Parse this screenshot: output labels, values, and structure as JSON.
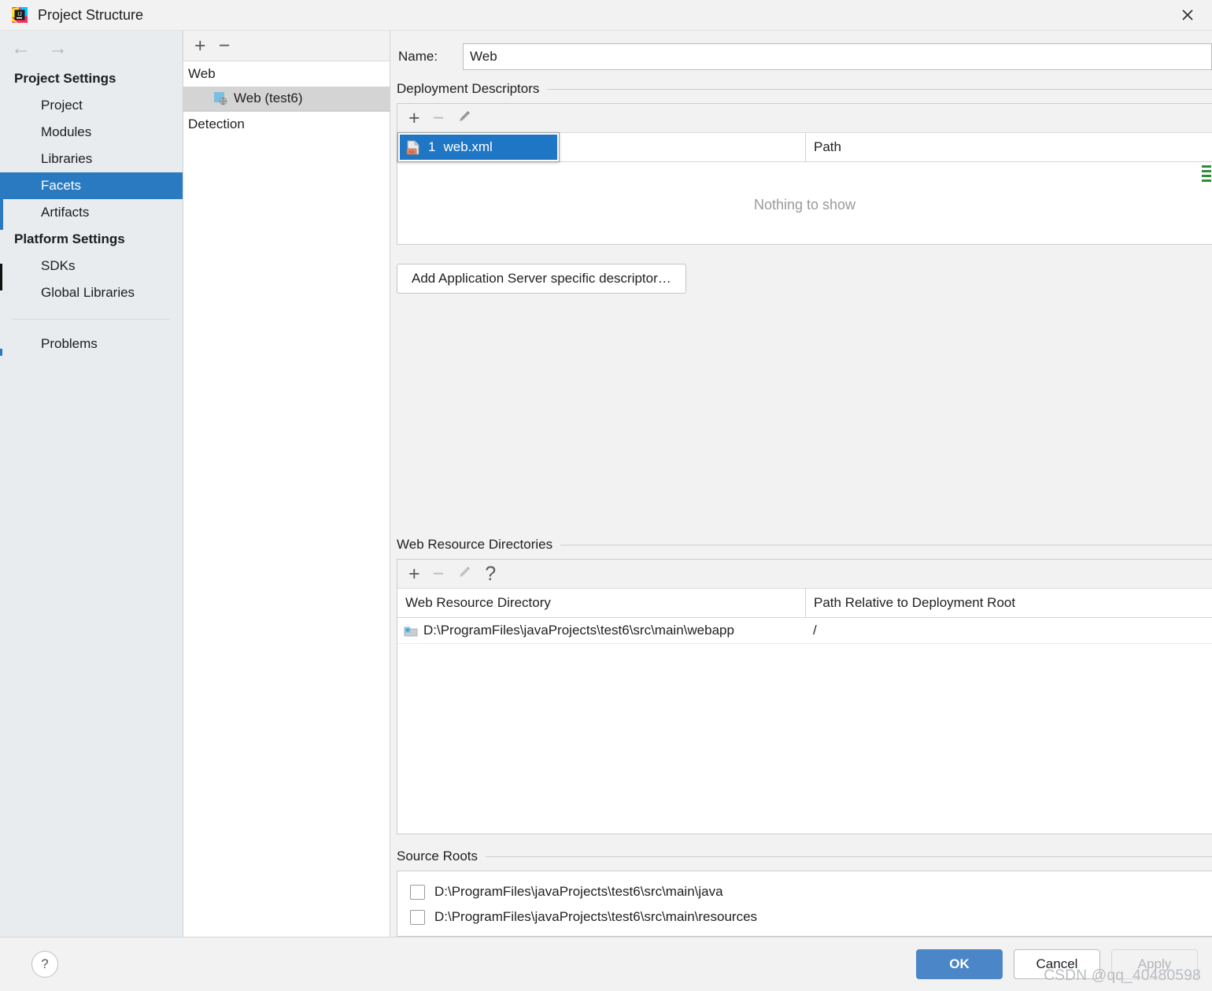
{
  "window": {
    "title": "Project Structure",
    "app_icon": "intellij-idea-icon",
    "close_icon": "close-icon"
  },
  "sidebar": {
    "nav": {
      "back_icon": "arrow-left-icon",
      "forward_icon": "arrow-right-icon"
    },
    "groups": [
      {
        "label": "Project Settings",
        "items": [
          "Project",
          "Modules",
          "Libraries",
          "Facets",
          "Artifacts"
        ]
      },
      {
        "label": "Platform Settings",
        "items": [
          "SDKs",
          "Global Libraries"
        ]
      }
    ],
    "selected": "Facets",
    "extra_items": [
      "Problems"
    ]
  },
  "facets_panel": {
    "toolbar": {
      "add": "+",
      "remove": "−"
    },
    "header": "Web",
    "item": {
      "label": "Web (test6)",
      "icon": "web-facet-icon"
    },
    "detection": "Detection"
  },
  "main": {
    "name": {
      "label": "Name:",
      "value": "Web",
      "placeholder": ""
    },
    "deployment_descriptors": {
      "title": "Deployment Descriptors",
      "toolbar": {
        "add": "+",
        "remove": "−",
        "edit": "pencil-icon"
      },
      "columns": [
        "",
        "Path"
      ],
      "rows": [],
      "empty_message": "Nothing to show",
      "add_button": "Add Application Server specific descriptor…",
      "popup": {
        "items": [
          {
            "shortcut": "1",
            "label": "web.xml",
            "icon": "xml-file-icon",
            "selected": true
          }
        ]
      }
    },
    "web_resource_directories": {
      "title": "Web Resource Directories",
      "toolbar": {
        "add": "+",
        "remove": "−",
        "edit": "pencil-icon",
        "help": "?"
      },
      "columns": [
        "Web Resource Directory",
        "Path Relative to Deployment Root"
      ],
      "rows": [
        {
          "directory": "D:\\ProgramFiles\\javaProjects\\test6\\src\\main\\webapp",
          "path": "/",
          "icon": "folder-icon"
        }
      ]
    },
    "source_roots": {
      "title": "Source Roots",
      "items": [
        {
          "label": "D:\\ProgramFiles\\javaProjects\\test6\\src\\main\\java",
          "checked": false
        },
        {
          "label": "D:\\ProgramFiles\\javaProjects\\test6\\src\\main\\resources",
          "checked": false
        }
      ]
    }
  },
  "footer": {
    "help": "?",
    "ok": "OK",
    "cancel": "Cancel",
    "apply": "Apply",
    "watermark": "CSDN @qq_40480598"
  },
  "colors": {
    "accent_selected": "#2a7ac2",
    "popup_selected": "#1f76c4",
    "ok_button": "#4a86c8",
    "sidebar_bg": "#e8ecef",
    "dialog_bg": "#f2f2f2",
    "xml_icon_badge": "#d97b5e",
    "facet_icon": "#77c0e3",
    "marker_green": "#2f8c3b"
  }
}
